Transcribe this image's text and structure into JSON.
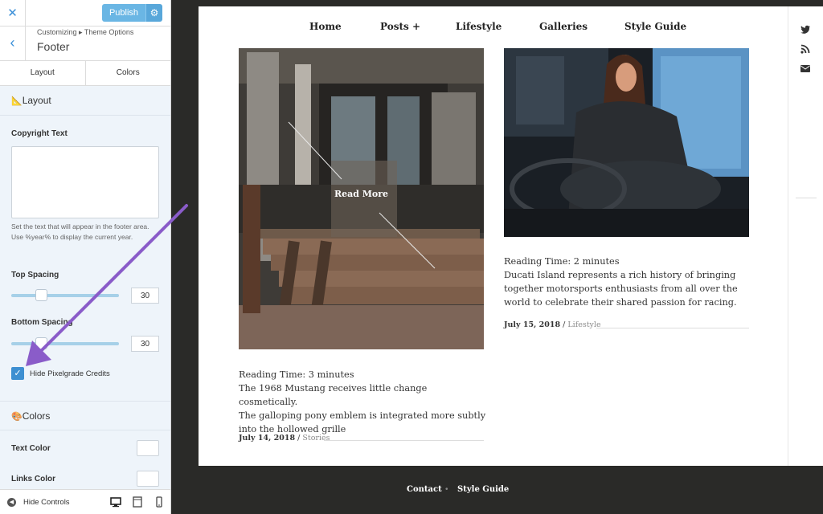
{
  "customizer": {
    "close_glyph": "✕",
    "publish_label": "Publish",
    "gear_glyph": "⚙",
    "back_glyph": "‹",
    "breadcrumb": "Customizing ▸ Theme Options",
    "section_title": "Footer",
    "tabs": [
      {
        "label": "Layout"
      },
      {
        "label": "Colors"
      }
    ],
    "layout_group": {
      "icon": "📐",
      "title": "Layout",
      "copyright_label": "Copyright Text",
      "copyright_value": "",
      "copyright_help": "Set the text that will appear in the footer area. Use %year% to display the current year.",
      "top_spacing_label": "Top Spacing",
      "top_spacing_value": "30",
      "bottom_spacing_label": "Bottom Spacing",
      "bottom_spacing_value": "30",
      "hide_credits_label": "Hide Pixelgrade Credits",
      "hide_credits_checked": true,
      "check_glyph": "✓"
    },
    "colors_group": {
      "icon": "🎨",
      "title": "Colors",
      "text_color_label": "Text Color",
      "links_color_label": "Links Color"
    },
    "footer": {
      "hide_controls_label": "Hide Controls",
      "hide_icon_glyph": "◀",
      "devices": [
        "desktop-icon",
        "tablet-icon",
        "mobile-icon"
      ]
    },
    "annotation_arrow_color": "#8a5cc9",
    "accent_color": "#3d8fd1"
  },
  "site": {
    "nav": [
      {
        "label": "Home"
      },
      {
        "label": "Posts +"
      },
      {
        "label": "Lifestyle"
      },
      {
        "label": "Galleries"
      },
      {
        "label": "Style Guide"
      }
    ],
    "social_icons": [
      "twitter-icon",
      "rss-icon",
      "envelope-icon"
    ],
    "posts": [
      {
        "read_more": "Read More",
        "reading_time": "Reading Time: 3 minutes",
        "excerpt_lines": [
          "The 1968 Mustang receives little change cosmetically.",
          "The galloping pony emblem is integrated more subtly",
          "into the hollowed grille"
        ],
        "date": "July 14, 2018",
        "separator": " / ",
        "category": "Stories"
      },
      {
        "reading_time": "Reading Time: 2 minutes",
        "excerpt_lines": [
          "Ducati Island represents a rich history of bringing",
          "together motorsports enthusiasts from all over the",
          "world to celebrate their shared passion for racing."
        ],
        "date": "July 15, 2018",
        "separator": " / ",
        "category": "Lifestyle"
      }
    ],
    "footer_links": [
      {
        "label": "Contact"
      },
      {
        "label": "Style Guide"
      }
    ],
    "footer_separator": "•"
  }
}
